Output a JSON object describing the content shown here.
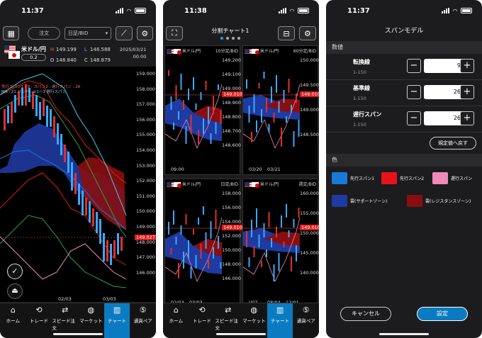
{
  "screens": [
    {
      "status_time": "11:37"
    },
    {
      "status_time": "11:38"
    },
    {
      "status_time": "11:37"
    }
  ],
  "tabbar": [
    {
      "label": "ホーム",
      "icon": "home-icon"
    },
    {
      "label": "トレード",
      "icon": "trade-icon"
    },
    {
      "label": "スピード注文",
      "icon": "speed-order-icon"
    },
    {
      "label": "マーケット",
      "icon": "market-globe-icon"
    },
    {
      "label": "チャート",
      "icon": "chart-icon"
    },
    {
      "label": "通貨ペア",
      "icon": "currency-pair-icon"
    }
  ],
  "chart_screen": {
    "order_button": "注文",
    "timeframe": "日足/BID",
    "pair": "米ドル/円",
    "spread": "0.2",
    "ohlc": {
      "h_label": "H",
      "h": "149.199",
      "l_label": "L",
      "l": "148.588",
      "o_label": "O",
      "o": "148.840",
      "c_label": "C",
      "c": "148.879"
    },
    "date": "2025/03/21",
    "time": "00:00",
    "legend1": "先行スパン1 : 9 : スパン2 : 遅行スパン : 26",
    "legend2": "MA : 21 バンド : ±1〜3  遅行スパン",
    "y_ticks": [
      "159.000",
      "158.000",
      "157.000",
      "156.000",
      "155.000",
      "154.000",
      "153.000",
      "152.000",
      "151.000",
      "150.000",
      "149.000",
      "148.000",
      "147.000",
      "146.000"
    ],
    "x_ticks": [
      "02/03",
      "03/03"
    ],
    "current_price": "149.027",
    "colors": {
      "span1": "#1a78d8",
      "span2": "#e01a1a",
      "cloud_support": "#1f3aa0",
      "cloud_resistance": "#8a0e10"
    }
  },
  "split_screen": {
    "title": "分割チャート1",
    "charts": [
      {
        "pair": "米ドル/円",
        "tf": "10分足/BID",
        "ticks": [
          "149.200",
          "149.100",
          "149.000",
          "148.900",
          "148.800",
          "148.700",
          "148.600"
        ],
        "x_ticks": [
          "09:00"
        ],
        "price": "149.010"
      },
      {
        "pair": "米ドル/円",
        "tf": "60分足/BID",
        "ticks": [
          "150.000",
          "149.500",
          "149.000",
          "148.500"
        ],
        "x_ticks": [
          "03/20",
          "03/21"
        ],
        "price": "149.010"
      },
      {
        "pair": "米ドル/円",
        "tf": "日足/BID",
        "ticks": [
          "158.000",
          "156.000",
          "154.000",
          "152.000",
          "150.000",
          "148.000",
          "146.000"
        ],
        "x_ticks": [
          "02/03",
          "03/03"
        ],
        "price": "149.010"
      },
      {
        "pair": "米ドル/円",
        "tf": "週足/BID",
        "ticks": [
          "160.000",
          "155.000",
          "150.000",
          "145.000",
          "140.000"
        ],
        "x_ticks": [
          "I/07",
          "08/04",
          "12/01"
        ],
        "price": "149.010"
      }
    ]
  },
  "ichimoku_screen": {
    "title": "スパンモデル",
    "values_section": "数値",
    "params": [
      {
        "name": "転換線",
        "range": "1-150",
        "value": "9"
      },
      {
        "name": "基準線",
        "range": "1-150",
        "value": "26"
      },
      {
        "name": "遅行スパン",
        "range": "1-150",
        "value": "26"
      }
    ],
    "reset_label": "規定値へ戻す",
    "color_section": "色",
    "colors": [
      {
        "label": "先行スパン1",
        "color": "#1a78d8"
      },
      {
        "label": "先行スパン2",
        "color": "#e8121a"
      },
      {
        "label": "遅行スパン",
        "color": "#f08ab8"
      },
      {
        "label": "雲(サポートゾーン)",
        "color": "#1f3aa0"
      },
      {
        "label": "雲(レジスタンスゾーン)",
        "color": "#8a0e10"
      }
    ],
    "cancel_label": "キャンセル",
    "ok_label": "設定"
  }
}
